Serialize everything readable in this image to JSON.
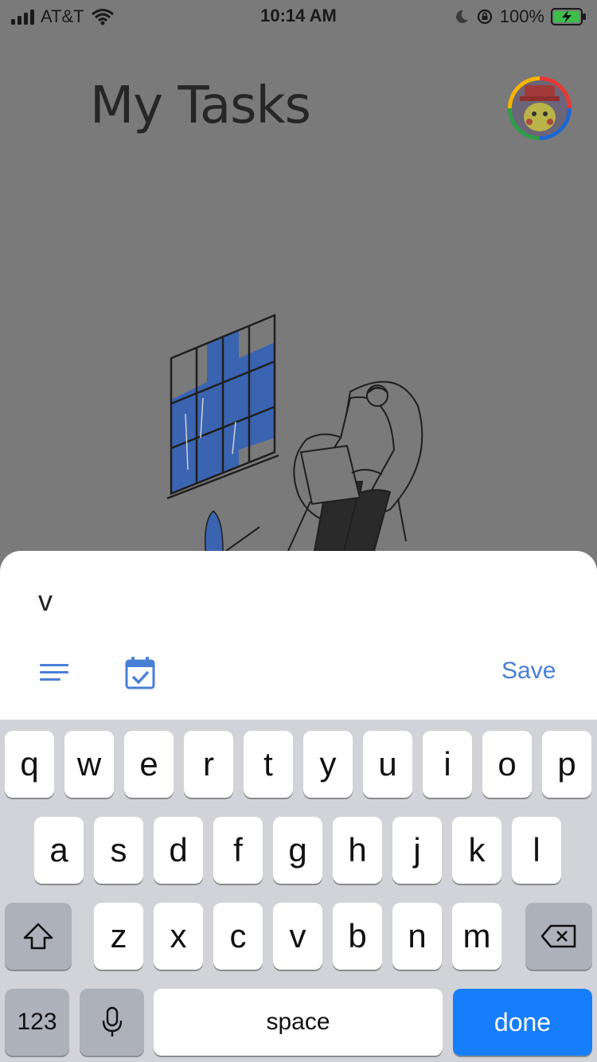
{
  "status_bar": {
    "carrier": "AT&T",
    "time": "10:14 AM",
    "battery_pct": "100%"
  },
  "header": {
    "title": "My Tasks"
  },
  "sheet": {
    "task_text": "v",
    "save_label": "Save"
  },
  "keyboard": {
    "row1": [
      "q",
      "w",
      "e",
      "r",
      "t",
      "y",
      "u",
      "i",
      "o",
      "p"
    ],
    "row2": [
      "a",
      "s",
      "d",
      "f",
      "g",
      "h",
      "j",
      "k",
      "l"
    ],
    "row3": [
      "z",
      "x",
      "c",
      "v",
      "b",
      "n",
      "m"
    ],
    "num_label": "123",
    "space_label": "space",
    "done_label": "done"
  },
  "colors": {
    "accent": "#4a7fd6",
    "done_key": "#167efb",
    "illustration_window": "#3b64b0"
  }
}
